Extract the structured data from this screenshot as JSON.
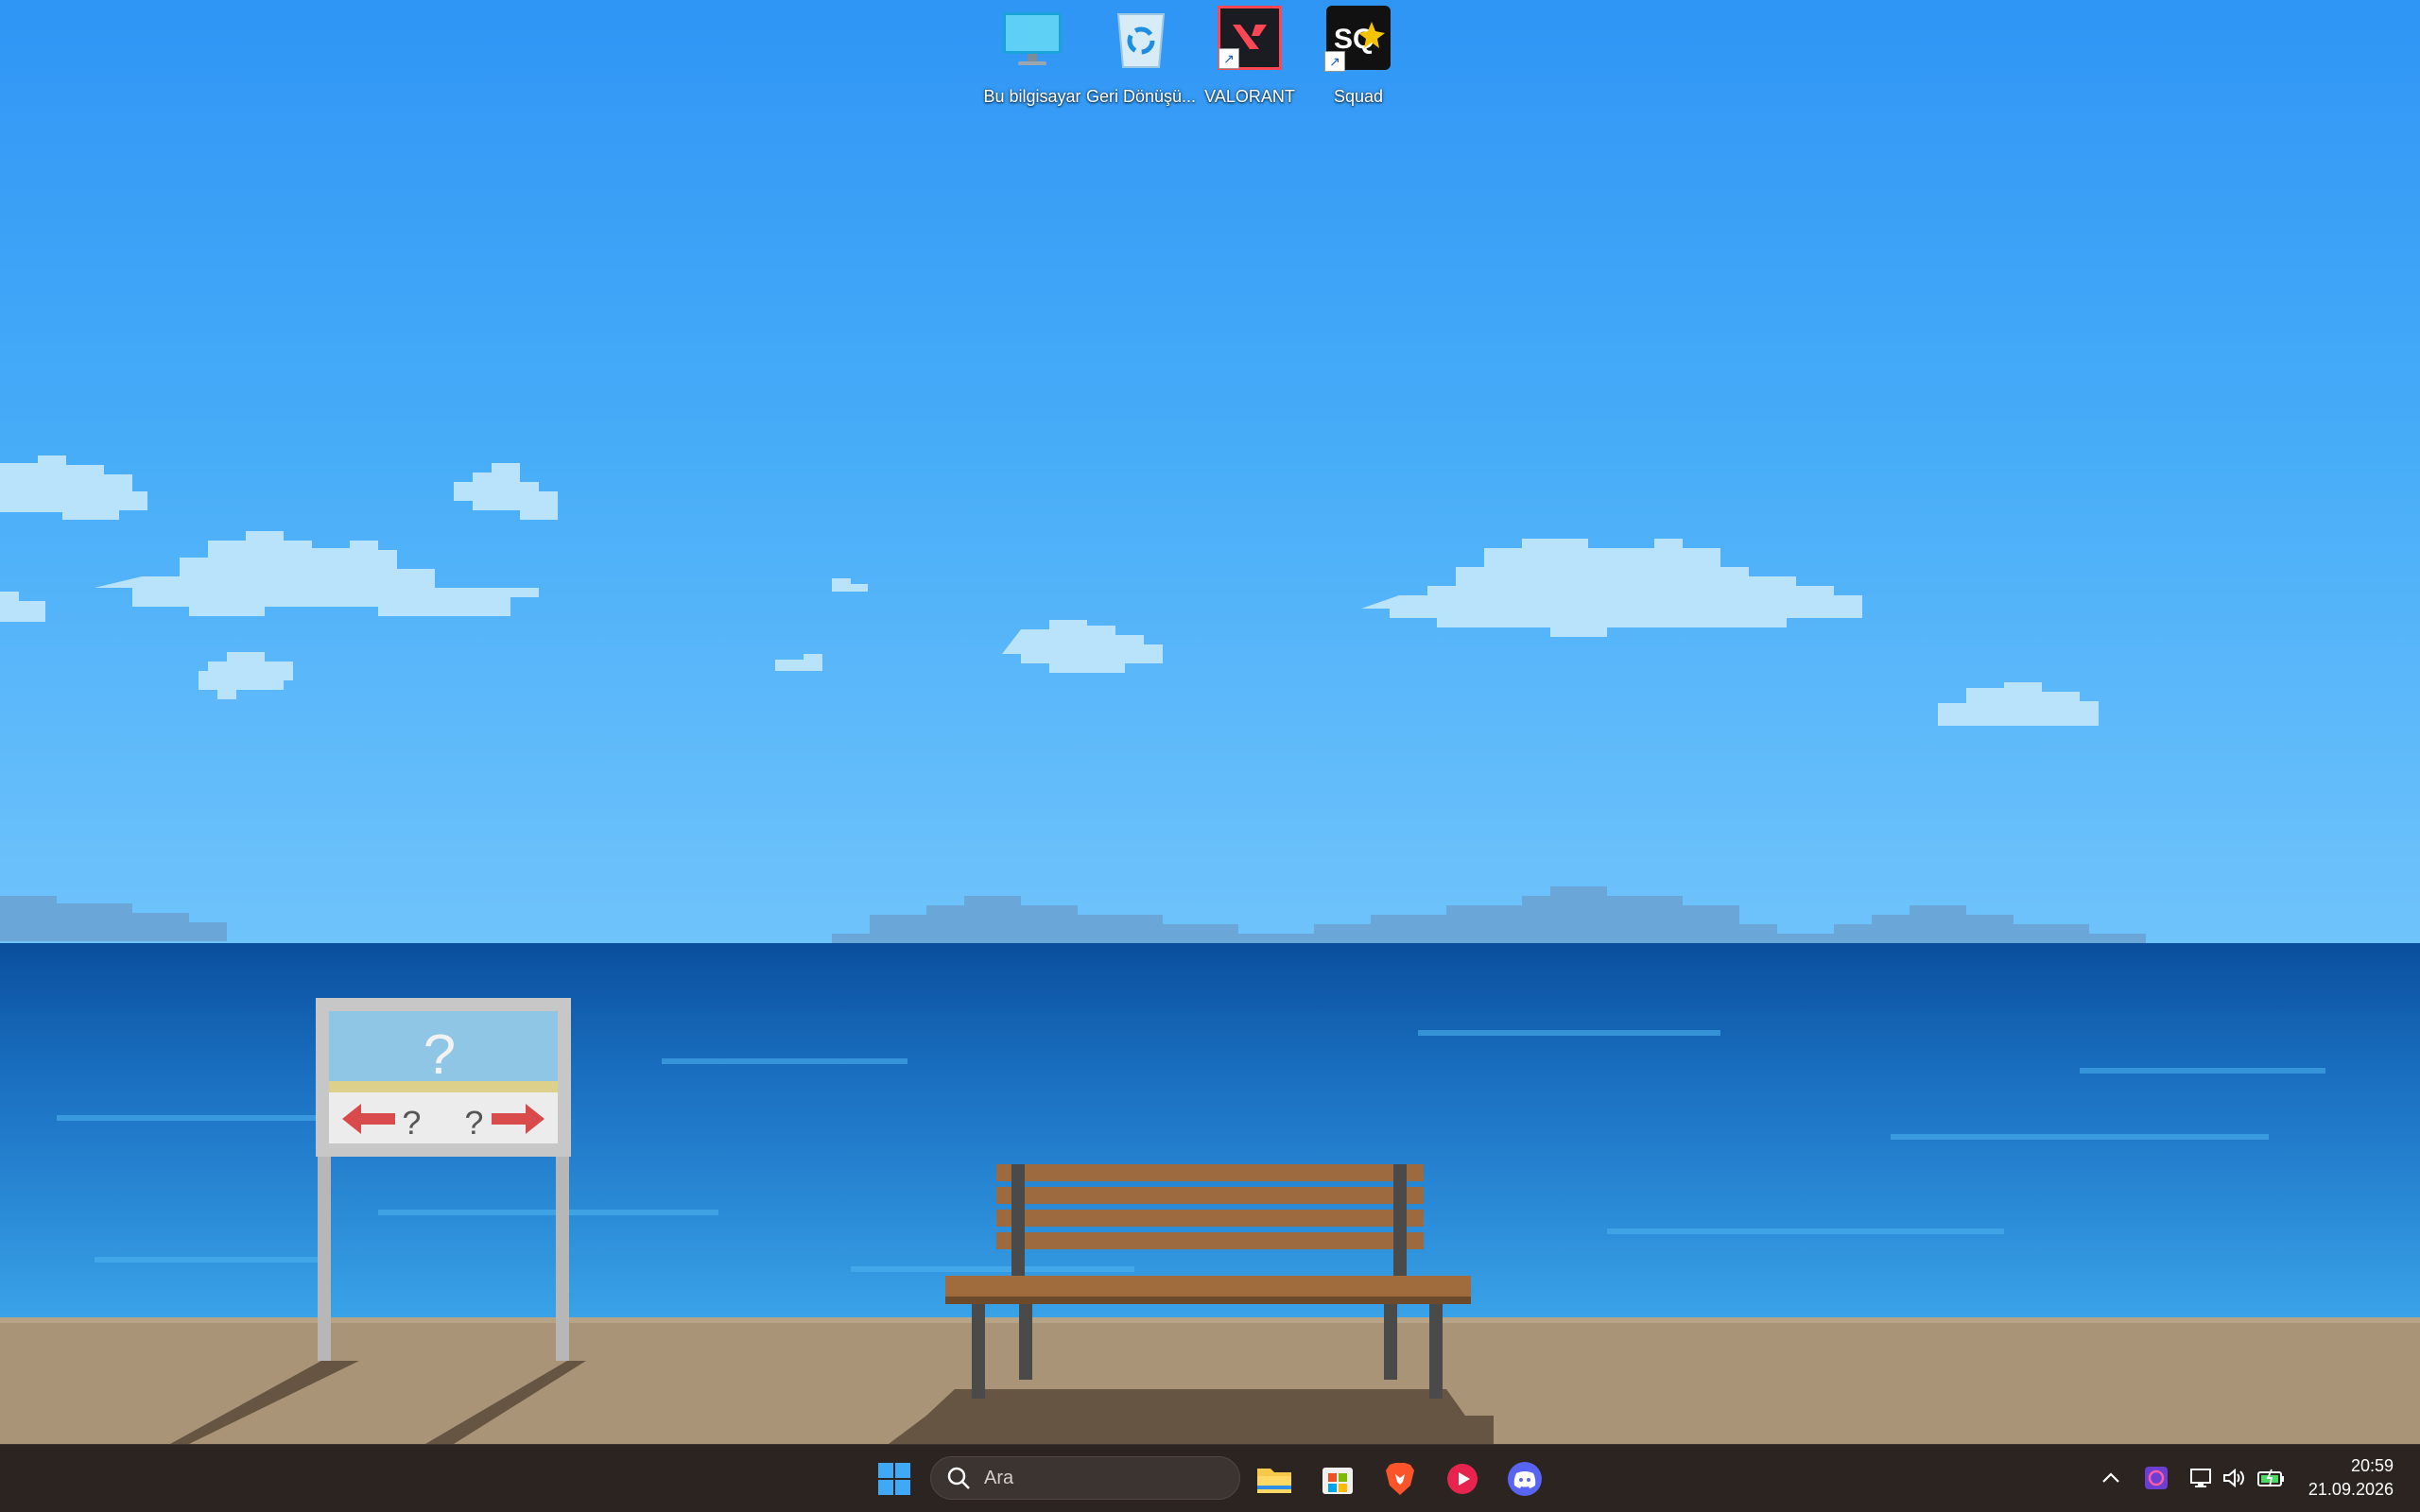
{
  "desktop_icons": [
    {
      "label": "Bu bilgisayar",
      "icon": "computer-icon"
    },
    {
      "label": "Geri Dönüşü...",
      "icon": "recycle-bin-icon"
    },
    {
      "label": "VALORANT",
      "icon": "valorant-icon"
    },
    {
      "label": "Squad",
      "icon": "squad-icon"
    }
  ],
  "wallpaper": {
    "sign_question": "?",
    "sign_left": "?",
    "sign_right": "?"
  },
  "taskbar": {
    "search_placeholder": "Ara",
    "pinned": [
      "start-icon",
      "file-explorer-icon",
      "microsoft-store-icon",
      "brave-browser-icon",
      "media-player-icon",
      "discord-icon"
    ],
    "clock_time": "20:59",
    "clock_date": "21.09.2026"
  },
  "colors": {
    "sky_top": "#2f95f5",
    "sea": "#1268b8",
    "sand": "#a99478",
    "taskbar": "#2b2421"
  }
}
